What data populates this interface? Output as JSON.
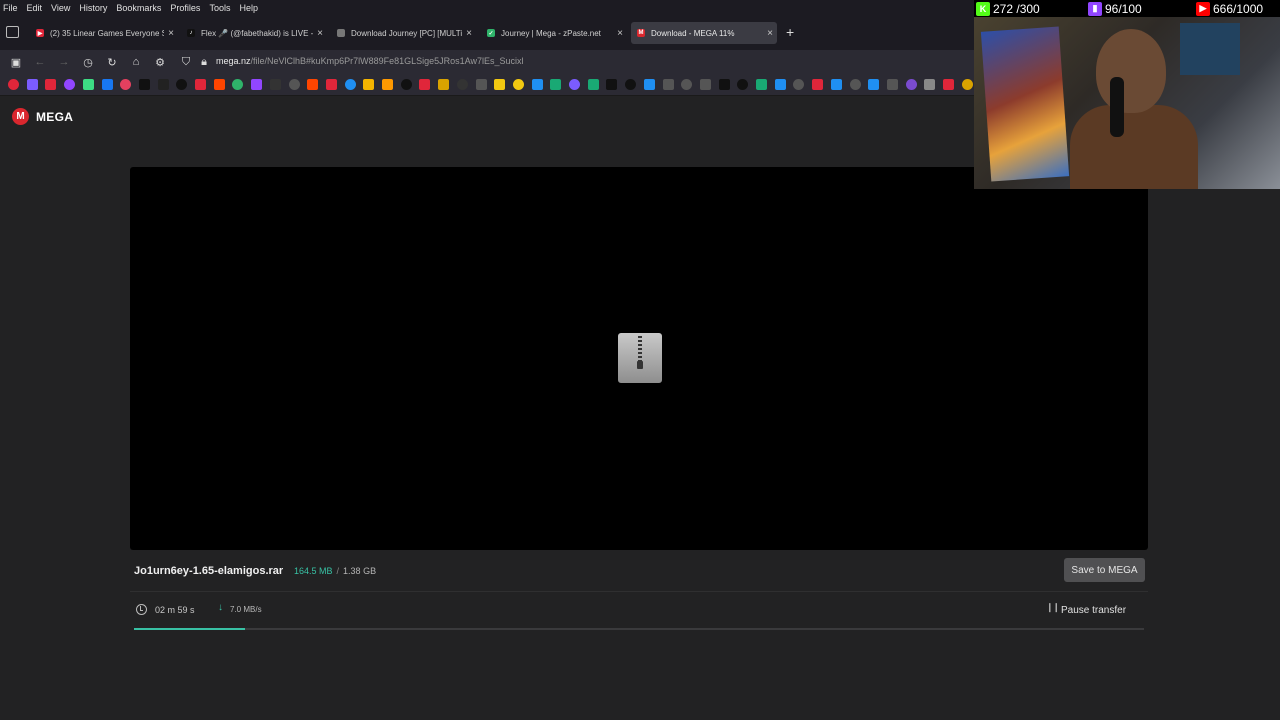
{
  "menu": [
    "File",
    "Edit",
    "View",
    "History",
    "Bookmarks",
    "Profiles",
    "Tools",
    "Help"
  ],
  "tabs": [
    {
      "title": "(2) 35 Linear Games Everyone S",
      "color": "#e0263a",
      "glyph": "▶",
      "active": false
    },
    {
      "title": "Flex 🎤 (@fabethakid) is LIVE - ",
      "color": "#111111",
      "glyph": "♪",
      "active": false
    },
    {
      "title": "Download Journey [PC] [MULTi",
      "color": "#777777",
      "glyph": "",
      "active": false
    },
    {
      "title": "Journey | Mega - zPaste.net",
      "color": "#2fb36a",
      "glyph": "✓",
      "active": false
    },
    {
      "title": "Download - MEGA 11%",
      "color": "#d9272e",
      "glyph": "M",
      "active": true
    }
  ],
  "url": {
    "host": "mega.nz",
    "path": "/file/NeVlClhB#kuKmp6Pr7lW889Fe81GLSige5JRos1Aw7lEs_Sucixl"
  },
  "bookmark_colors": [
    "#e0263a",
    "#7b5cff",
    "#e0263a",
    "#9146ff",
    "#3ddc84",
    "#1877f2",
    "#e4405f",
    "#111111",
    "#222222",
    "#111111",
    "#e0263a",
    "#ff4500",
    "#2fb36a",
    "#9146ff",
    "#333333",
    "#555555",
    "#ff4500",
    "#e0263a",
    "#1f8ff2",
    "#f4b400",
    "#ff9900",
    "#111111",
    "#e0263a",
    "#d9a300",
    "#333333",
    "#555555",
    "#f2c811",
    "#f2c811",
    "#1f8ff2",
    "#19a974",
    "#7b5cff",
    "#19a974",
    "#111111",
    "#111111",
    "#1f8ff2",
    "#555555",
    "#555555",
    "#555555",
    "#111111",
    "#111111",
    "#19a974",
    "#1f8ff2",
    "#555555",
    "#e0263a",
    "#1f8ff2",
    "#555555",
    "#1f8ff2",
    "#555555",
    "#7a4bd0",
    "#888888",
    "#e0263a",
    "#d9a300",
    "#e0263a",
    "#ff9900",
    "#1f8ff2"
  ],
  "brand": {
    "name": "MEGA",
    "mark": "M"
  },
  "file": {
    "name": "Jo1urn6ey-1.65-elamigos.rar",
    "downloaded": "164.5 MB",
    "separator": "/",
    "total": "1.38 GB"
  },
  "save_label": "Save to MEGA",
  "transfer": {
    "time_left": "02 m  59 s",
    "speed": "7.0 MB/s",
    "pause_label": "Pause transfer",
    "progress": 0.11
  },
  "overlay": {
    "kick": "272 /300",
    "twitch": "96/100",
    "youtube": "666/1000"
  },
  "colors": {
    "accent": "#38c1a4",
    "brand": "#d9272e",
    "kick": "#53fc18",
    "twitch": "#9146ff",
    "youtube": "#ff0000"
  }
}
